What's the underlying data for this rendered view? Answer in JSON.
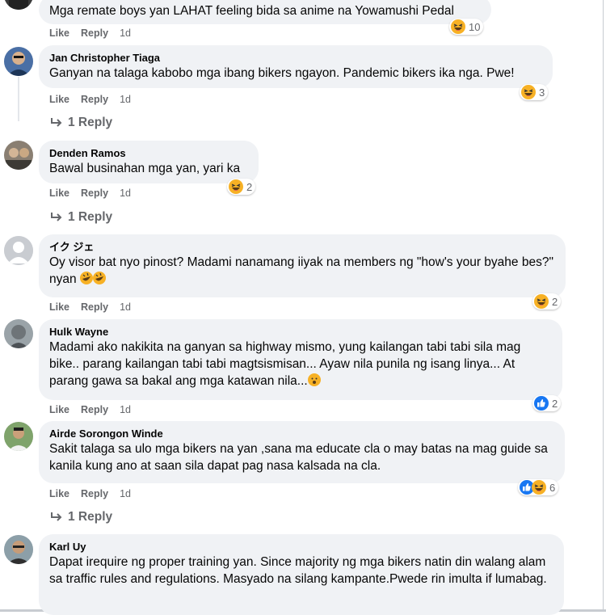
{
  "labels": {
    "like": "Like",
    "reply": "Reply"
  },
  "comments": [
    {
      "author": "",
      "text": "Mga remate boys yan LAHAT feeling bida sa anime na Yowamushi Pedal",
      "time": "1d",
      "reaction_count": "10",
      "reaction_icons": [
        "haha-icon"
      ]
    },
    {
      "author": "Jan Christopher Tiaga",
      "text": "Ganyan na talaga kabobo mga ibang bikers ngayon. Pandemic bikers ika nga. Pwe!",
      "time": "1d",
      "reaction_count": "3",
      "reaction_icons": [
        "haha-icon"
      ],
      "replies": "1 Reply"
    },
    {
      "author": "Denden Ramos",
      "text": "Bawal businahan mga yan, yari ka",
      "time": "1d",
      "reaction_count": "2",
      "reaction_icons": [
        "haha-icon"
      ],
      "replies": "1 Reply"
    },
    {
      "author": "イク ジェ",
      "text": "Oy visor bat nyo pinost? Madami nanamang iiyak na members ng \"how's your byahe bes?\" nyan",
      "inline_emoji": [
        "rofl-icon",
        "rofl-icon"
      ],
      "time": "1d",
      "reaction_count": "2",
      "reaction_icons": [
        "haha-icon"
      ]
    },
    {
      "author": "Hulk Wayne",
      "text": "Madami ako nakikita na ganyan sa highway mismo, yung kailangan tabi tabi sila mag bike.. parang kailangan tabi tabi magtsismisan... Ayaw nila punila ng isang linya... At parang gawa sa bakal ang mga katawan nila...",
      "inline_emoji": [
        "frown-icon"
      ],
      "time": "1d",
      "reaction_count": "2",
      "reaction_icons": [
        "like-icon"
      ]
    },
    {
      "author": "Airde Sorongon Winde",
      "text": "Sakit talaga sa ulo mga bikers na yan ,sana ma educate cla o may batas na mag guide sa kanila kung ano at saan sila dapat pag nasa kalsada na cla.",
      "time": "1d",
      "reaction_count": "6",
      "reaction_icons": [
        "like-icon",
        "haha-icon"
      ],
      "replies": "1 Reply"
    },
    {
      "author": "Karl Uy",
      "text": "Dapat irequire ng proper training yan. Since majority ng mga bikers natin din walang alam sa traffic rules and regulations. Masyado na silang kampante.Pwede rin imulta if lumabag."
    }
  ],
  "colors": {
    "bubble": "#f0f2f5",
    "meta": "#65676b",
    "text": "#050505",
    "like_blue": "#1877f2",
    "haha_yellow": "#f7b125"
  }
}
